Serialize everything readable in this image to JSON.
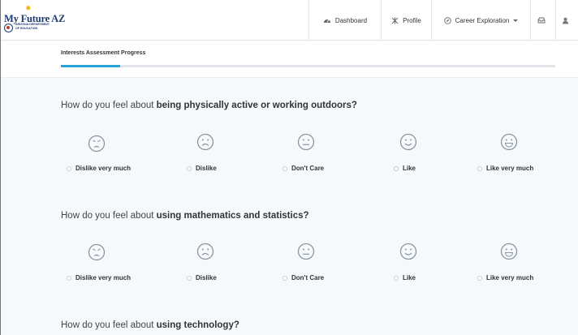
{
  "logo": {
    "title": "My Future AZ",
    "dept_line1": "ARIZONA DEPARTMENT",
    "dept_line2": "OF EDUCATION"
  },
  "nav": {
    "dashboard": "Dashboard",
    "profile": "Profile",
    "career": "Career Exploration"
  },
  "progress": {
    "label": "Interests Assessment Progress",
    "fraction": 0.12
  },
  "questions": [
    {
      "prefix": "How do you feel about ",
      "topic": "being physically active or working outdoors?"
    },
    {
      "prefix": "How do you feel about ",
      "topic": "using mathematics and statistics?"
    },
    {
      "prefix": "How do you feel about ",
      "topic": "using technology?"
    }
  ],
  "options": [
    "Dislike very much",
    "Dislike",
    "Don't Care",
    "Like",
    "Like very much"
  ],
  "colors": {
    "accent": "#2aa3d8",
    "brand": "#1f3c73",
    "face": "#8c959e"
  }
}
